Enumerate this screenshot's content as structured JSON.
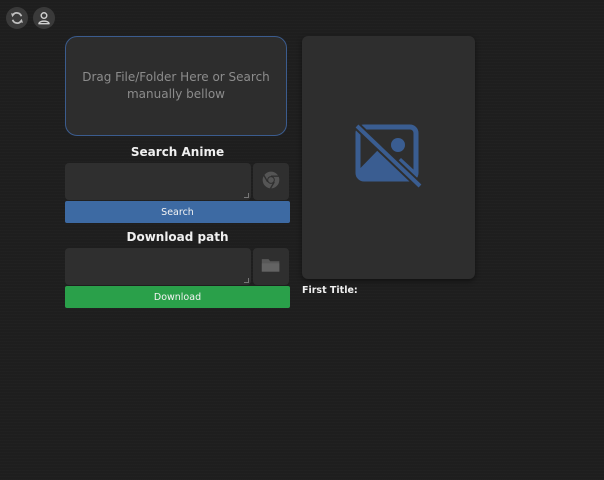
{
  "toolbar": {
    "refresh_icon": "refresh-icon",
    "user_icon": "user-icon"
  },
  "drop_zone": {
    "text": "Drag File/Folder Here or Search manually bellow"
  },
  "search": {
    "title": "Search Anime",
    "input_value": "",
    "browser_icon": "chrome-icon",
    "button_label": "Search"
  },
  "download": {
    "title": "Download path",
    "input_value": "",
    "folder_icon": "folder-icon",
    "button_label": "Download"
  },
  "preview": {
    "placeholder_icon": "image-off-icon",
    "first_title_label": "First Title:"
  },
  "colors": {
    "background": "#1e1e1e",
    "panel": "#2e2e2e",
    "accent_blue": "#3d6aa3",
    "accent_green": "#2aa04a",
    "drop_border": "#3b5c8e"
  }
}
